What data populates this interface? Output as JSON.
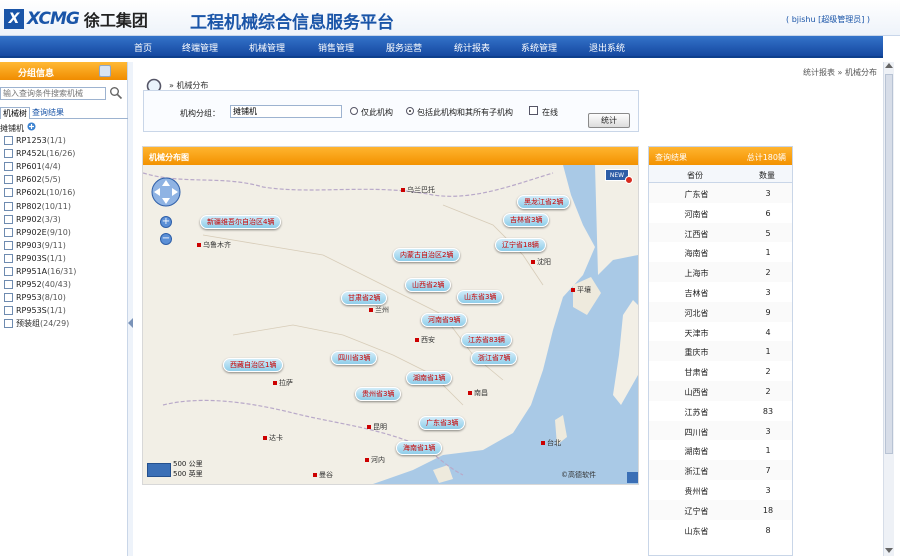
{
  "header": {
    "logo_en": "XCMG",
    "logo_cn": "徐工集团",
    "platform_title": "工程机械综合信息服务平台",
    "user": "( bjishu [超级管理员] )"
  },
  "nav": [
    "首页",
    "终端管理",
    "机械管理",
    "销售管理",
    "服务运营",
    "统计报表",
    "系统管理",
    "退出系统"
  ],
  "left": {
    "title": "分组信息",
    "search_placeholder": "输入查询条件搜索机械",
    "tabs": [
      "机械树",
      "查询结果"
    ],
    "root": "摊铺机",
    "items": [
      {
        "model": "RP1253",
        "count": "(1/1)"
      },
      {
        "model": "RP452L",
        "count": "(16/26)"
      },
      {
        "model": "RP601",
        "count": "(4/4)"
      },
      {
        "model": "RP602",
        "count": "(5/5)"
      },
      {
        "model": "RP602L",
        "count": "(10/16)"
      },
      {
        "model": "RP802",
        "count": "(10/11)"
      },
      {
        "model": "RP902",
        "count": "(3/3)"
      },
      {
        "model": "RP902E",
        "count": "(9/10)"
      },
      {
        "model": "RP903",
        "count": "(9/11)"
      },
      {
        "model": "RP903S",
        "count": "(1/1)"
      },
      {
        "model": "RP951A",
        "count": "(16/31)"
      },
      {
        "model": "RP952",
        "count": "(40/43)"
      },
      {
        "model": "RP953",
        "count": "(8/10)"
      },
      {
        "model": "RP953S",
        "count": "(1/1)"
      },
      {
        "model": "预装组",
        "count": "(24/29)"
      }
    ]
  },
  "content": {
    "breadcrumb": "统计报表 » 机械分布",
    "page_title": "» 机械分布",
    "filter": {
      "label": "机构分组：",
      "value": "摊铺机",
      "option1": "仅此机构",
      "option2": "包括此机构和其所有子机构",
      "option3": "在线",
      "button": "统计"
    }
  },
  "map": {
    "title": "机械分布图",
    "bubbles": [
      "新疆维吾尔自治区4辆",
      "黑龙江省2辆",
      "吉林省3辆",
      "辽宁省18辆",
      "内蒙古自治区2辆",
      "山西省2辆",
      "山东省3辆",
      "甘肃省2辆",
      "河南省9辆",
      "江苏省83辆",
      "四川省3辆",
      "浙江省7辆",
      "西藏自治区1辆",
      "湖南省1辆",
      "贵州省3辆",
      "广东省3辆",
      "海南省1辆"
    ],
    "cities": [
      "乌鲁木齐",
      "乌兰巴托",
      "沈阳",
      "平壤",
      "兰州",
      "西安",
      "拉萨",
      "南昌",
      "昆明",
      "台北",
      "达卡",
      "河内",
      "曼谷"
    ],
    "scale": [
      "500 公里",
      "500 英里"
    ],
    "copyright": "©高德软件",
    "new_badge": "NEW"
  },
  "stats": {
    "title": "查询结果",
    "total": "总计180辆",
    "col_province": "省份",
    "col_count": "数量",
    "rows": [
      {
        "province": "广东省",
        "count": "3"
      },
      {
        "province": "河南省",
        "count": "6"
      },
      {
        "province": "江西省",
        "count": "5"
      },
      {
        "province": "海南省",
        "count": "1"
      },
      {
        "province": "上海市",
        "count": "2"
      },
      {
        "province": "吉林省",
        "count": "3"
      },
      {
        "province": "河北省",
        "count": "9"
      },
      {
        "province": "天津市",
        "count": "4"
      },
      {
        "province": "重庆市",
        "count": "1"
      },
      {
        "province": "甘肃省",
        "count": "2"
      },
      {
        "province": "山西省",
        "count": "2"
      },
      {
        "province": "江苏省",
        "count": "83"
      },
      {
        "province": "四川省",
        "count": "3"
      },
      {
        "province": "湖南省",
        "count": "1"
      },
      {
        "province": "浙江省",
        "count": "7"
      },
      {
        "province": "贵州省",
        "count": "3"
      },
      {
        "province": "辽宁省",
        "count": "18"
      },
      {
        "province": "山东省",
        "count": "8"
      }
    ]
  },
  "colors": {
    "brand_blue": "#1a55a8",
    "nav_blue": "#1548a0",
    "orange": "#f39200",
    "bubble_text": "#c80000"
  }
}
